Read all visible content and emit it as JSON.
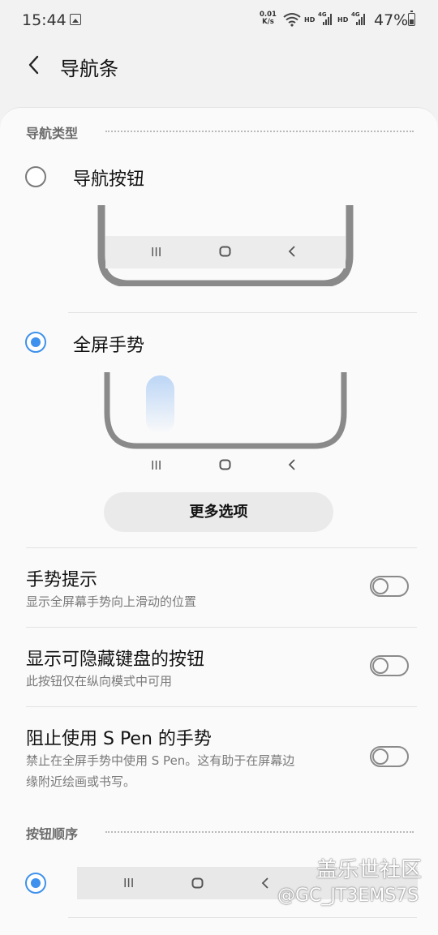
{
  "status_bar": {
    "time": "15:44",
    "net_speed_top": "0.01",
    "net_speed_bottom": "K/s",
    "sim1_label": "HD",
    "sim1_tech": "4G",
    "sim2_label": "HD",
    "sim2_tech": "4G",
    "battery": "47%"
  },
  "header": {
    "title": "导航条"
  },
  "nav_type": {
    "section_title": "导航类型",
    "options": [
      {
        "label": "导航按钮",
        "selected": false
      },
      {
        "label": "全屏手势",
        "selected": true
      }
    ],
    "nav_glyphs": {
      "recent": "III",
      "home": "O",
      "back": "<"
    },
    "more_button": "更多选项"
  },
  "settings": [
    {
      "title": "手势提示",
      "subtitle": "显示全屏幕手势向上滑动的位置",
      "on": false
    },
    {
      "title": "显示可隐藏键盘的按钮",
      "subtitle": "此按钮仅在纵向模式中可用",
      "on": false
    },
    {
      "title": "阻止使用 S Pen 的手势",
      "subtitle_line1": "禁止在全屏手势中使用 S Pen。这有助于在屏幕边",
      "subtitle_line2": "缘附近绘画或书写。",
      "on": false
    }
  ],
  "button_order": {
    "section_title": "按钮顺序"
  },
  "watermark": {
    "line1": "盖乐世社区",
    "line2": "@GC_JT3EMS7S"
  },
  "colors": {
    "accent": "#3e91ec",
    "background": "#f2f2f2",
    "card": "#fafafa",
    "gesture_hint": "#bcd6f6"
  }
}
